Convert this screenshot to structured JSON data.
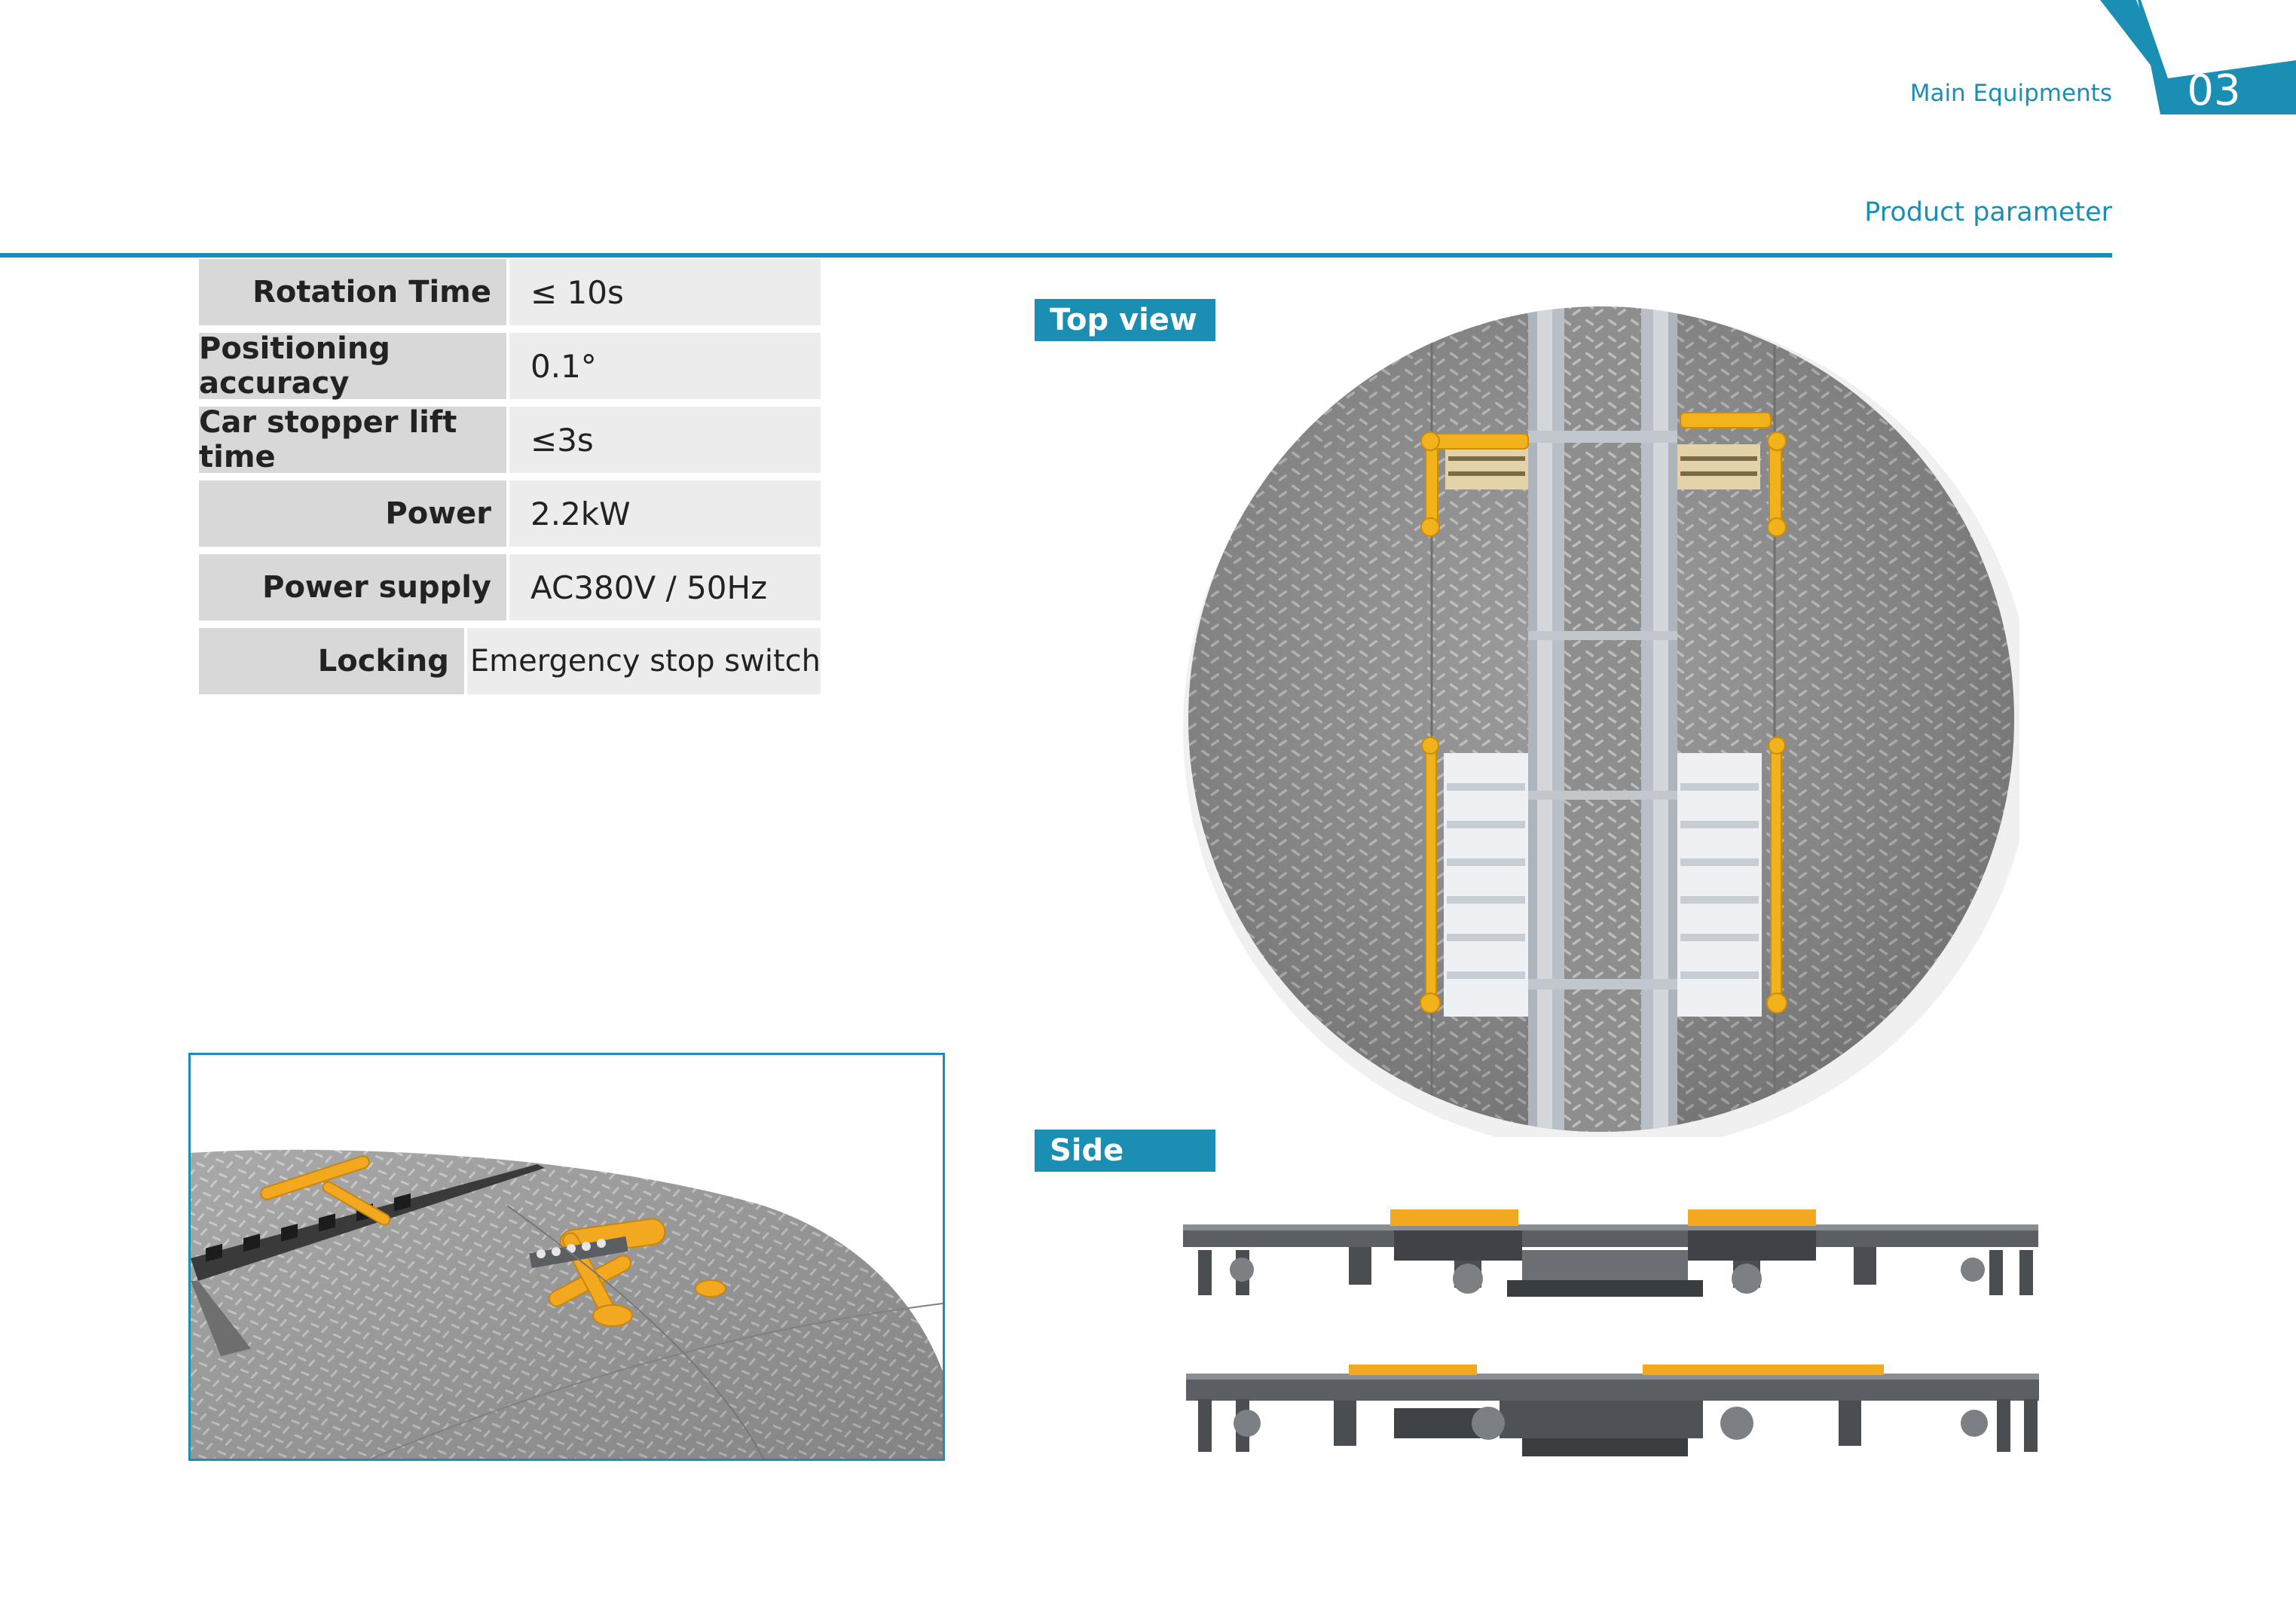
{
  "header": {
    "section": "Main Equipments",
    "page_number": "03",
    "subtitle": "Product parameter",
    "accent_color": "#1a8fb3"
  },
  "parameters": [
    {
      "label": "Rotation Time",
      "value": "≤ 10s"
    },
    {
      "label": "Positioning accuracy",
      "value": "0.1°"
    },
    {
      "label": "Car stopper lift time",
      "value": "≤3s"
    },
    {
      "label": "Power",
      "value": "2.2kW"
    },
    {
      "label": "Power supply",
      "value": "AC380V / 50Hz"
    },
    {
      "label": "Locking",
      "value": "Emergency stop switch"
    }
  ],
  "views": {
    "top_label": "Top view",
    "side_label": "Side view"
  },
  "colors": {
    "steel": "#8c8c8c",
    "rail": "#c9ced4",
    "yellow": "#f2a91f",
    "frame": "#5b5e62"
  }
}
